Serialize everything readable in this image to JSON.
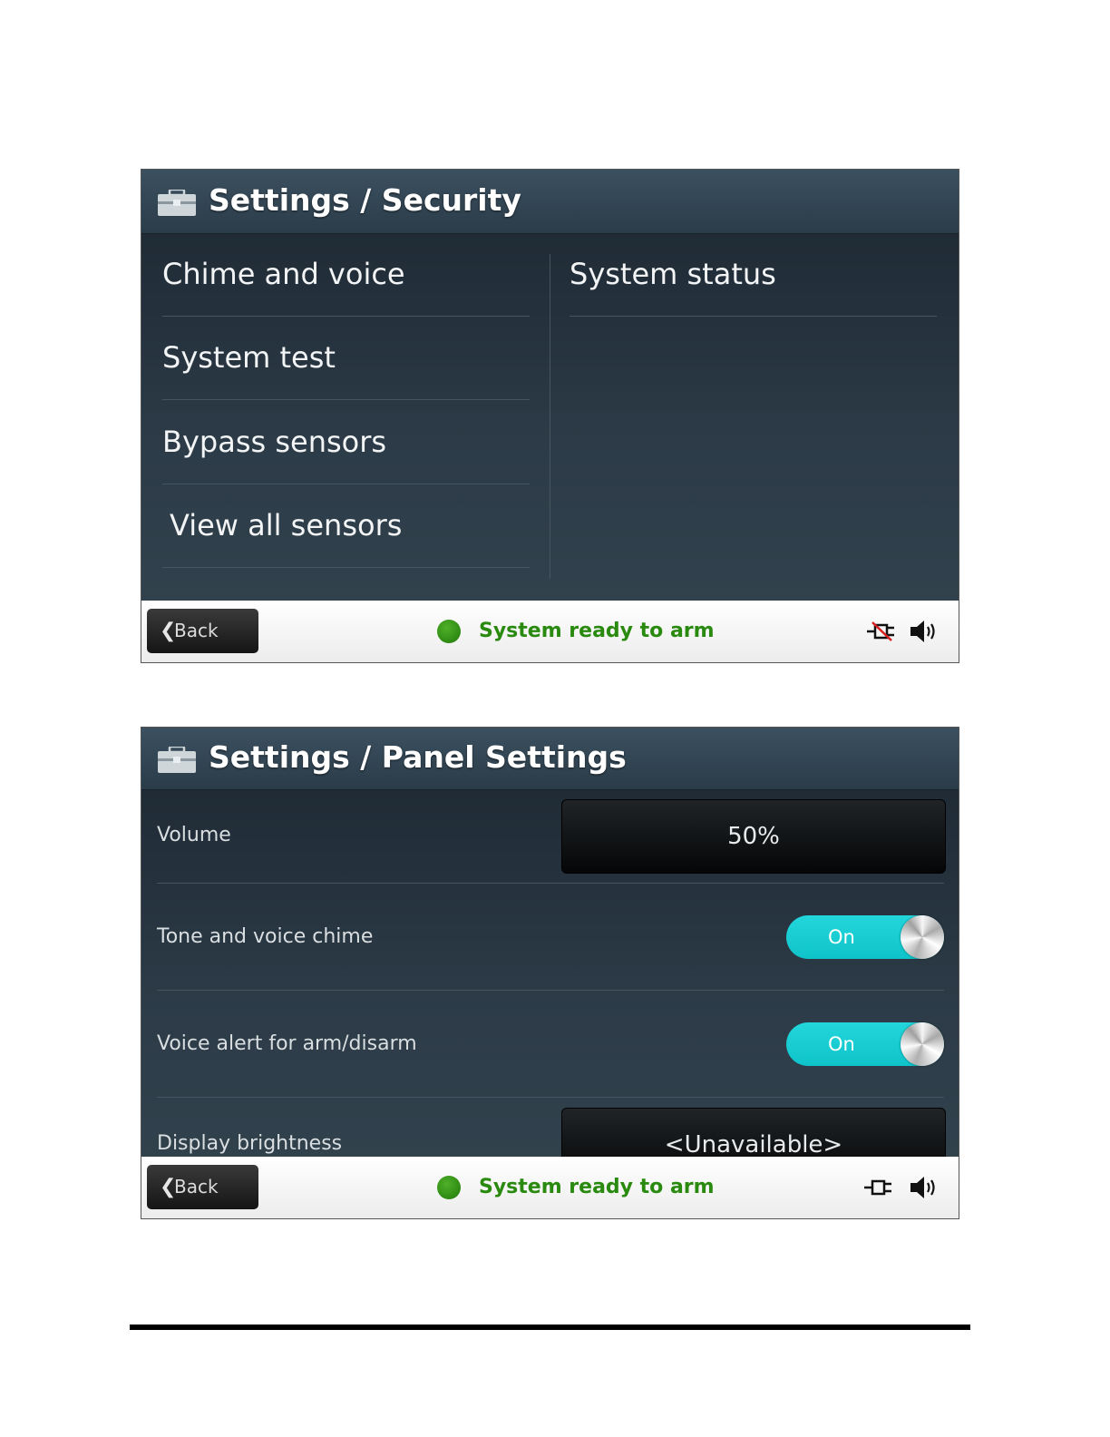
{
  "screen1": {
    "title": "Settings / Security",
    "left_items": [
      {
        "label": "Chime and voice"
      },
      {
        "label": "System test"
      },
      {
        "label": "Bypass sensors"
      },
      {
        "label": "View all sensors"
      }
    ],
    "right_items": [
      {
        "label": "System status"
      }
    ],
    "footer": {
      "back_label": "Back",
      "status_text": "System ready to arm",
      "status_color": "#2e8a12"
    }
  },
  "screen2": {
    "title": "Settings / Panel Settings",
    "rows": [
      {
        "label": "Volume",
        "value": "50%"
      },
      {
        "label": "Tone and voice chime",
        "toggle": "On"
      },
      {
        "label": "Voice alert for arm/disarm",
        "toggle": "On"
      },
      {
        "label": "Display brightness",
        "value": "<Unavailable>"
      }
    ],
    "footer": {
      "back_label": "Back",
      "status_text": "System ready to arm",
      "status_color": "#2e8a12"
    }
  },
  "colors": {
    "toggle_on": "#0ec3c9",
    "status_green": "#2a8a10"
  }
}
